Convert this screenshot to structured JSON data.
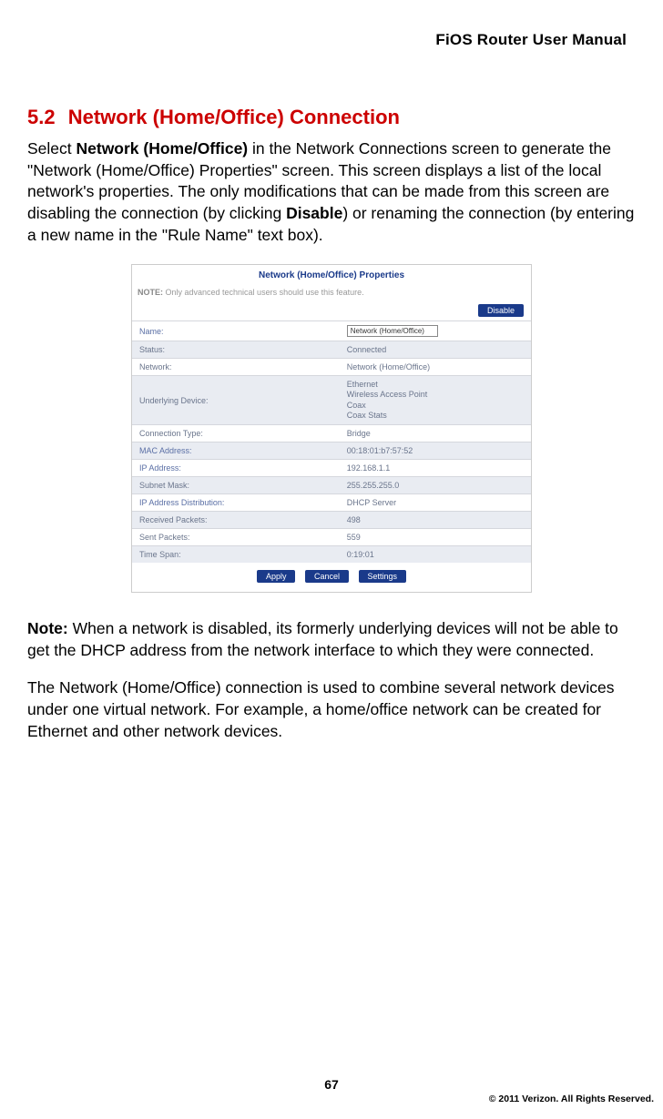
{
  "header": {
    "title": "FiOS Router User Manual"
  },
  "section": {
    "number": "5.2",
    "title": "Network (Home/Office) Connection"
  },
  "para1": {
    "pre": "Select ",
    "b1": "Network (Home/Office)",
    "mid1": " in the Network Connections screen to generate the \"Network (Home/Office) Properties\" screen. This screen displays a list of the local network's properties. The only modifications that can be made from this screen are disabling the connection (by clicking ",
    "b2": "Disable",
    "post": ") or renaming the connection (by entering a new name in the \"Rule Name\" text box)."
  },
  "figure": {
    "title": "Network (Home/Office) Properties",
    "note_label": "NOTE:",
    "note_text": " Only advanced technical users should use this feature.",
    "disable_btn": "Disable",
    "name_input": "Network (Home/Office)",
    "rows": [
      {
        "label": "Name:",
        "value": "",
        "alt": false,
        "input": true,
        "label_blue": true
      },
      {
        "label": "Status:",
        "value": "Connected",
        "alt": true,
        "green": true
      },
      {
        "label": "Network:",
        "value": "Network (Home/Office)",
        "alt": false
      },
      {
        "label": "Underlying Device:",
        "value_multi": [
          "Ethernet",
          "Wireless Access Point",
          "Coax",
          "Coax Stats"
        ],
        "alt": true
      },
      {
        "label": "Connection Type:",
        "value": "Bridge",
        "alt": false
      },
      {
        "label": "MAC Address:",
        "value": "00:18:01:b7:57:52",
        "alt": true,
        "label_blue": true
      },
      {
        "label": "IP Address:",
        "value": "192.168.1.1",
        "alt": false,
        "label_blue": true
      },
      {
        "label": "Subnet Mask:",
        "value": "255.255.255.0",
        "alt": true
      },
      {
        "label": "IP Address Distribution:",
        "value": "DHCP Server",
        "alt": false,
        "label_blue": true
      },
      {
        "label": "Received Packets:",
        "value": "498",
        "alt": true
      },
      {
        "label": "Sent Packets:",
        "value": "559",
        "alt": false
      },
      {
        "label": "Time Span:",
        "value": "0:19:01",
        "alt": true
      }
    ],
    "buttons": {
      "apply": "Apply",
      "cancel": "Cancel",
      "settings": "Settings"
    }
  },
  "note_para": {
    "label": "Note:",
    "text": " When a network is disabled, its formerly underlying devices will not be able to get the DHCP address from the network interface to which they were connected."
  },
  "para2": "The Network (Home/Office) connection is used to combine several network devices under one virtual network. For example, a home/office network can be created for Ethernet and other network devices.",
  "footer": {
    "page": "67",
    "copyright": "© 2011 Verizon. All Rights Reserved."
  }
}
